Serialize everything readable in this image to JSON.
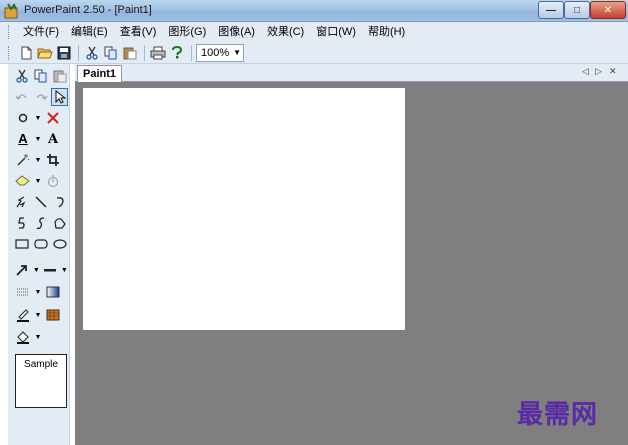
{
  "window": {
    "title": "PowerPaint 2.50 - [Paint1]",
    "minimize": "—",
    "maximize": "□",
    "close": "✕"
  },
  "menu": [
    {
      "id": "file",
      "label": "文件(F)"
    },
    {
      "id": "edit",
      "label": "编辑(E)"
    },
    {
      "id": "view",
      "label": "查看(V)"
    },
    {
      "id": "shape",
      "label": "图形(G)"
    },
    {
      "id": "image",
      "label": "图像(A)"
    },
    {
      "id": "effect",
      "label": "效果(C)"
    },
    {
      "id": "window",
      "label": "窗口(W)"
    },
    {
      "id": "help",
      "label": "帮助(H)"
    }
  ],
  "toolbar": {
    "zoom": "100%",
    "icons": [
      "new-file-icon",
      "open-folder-icon",
      "save-icon",
      "cut-icon",
      "copy-icon",
      "paste-icon",
      "print-icon",
      "help-icon"
    ]
  },
  "tools": {
    "text_tool_glyph": "A",
    "font_glyph": "A",
    "sample_label": "Sample"
  },
  "tabs": {
    "active": "Paint1",
    "prev": "◁",
    "next": "▷",
    "close": "✕"
  },
  "watermark": "最需网",
  "colors": {
    "panel": "#e3ebf5",
    "workspace": "#7f7f7f",
    "watermark": "#5a2aa6",
    "delete_red": "#d42020"
  }
}
